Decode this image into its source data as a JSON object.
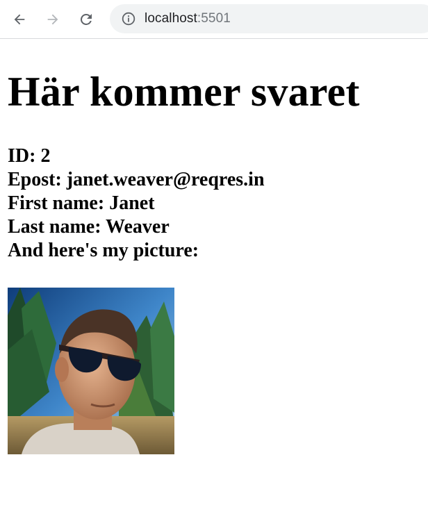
{
  "browser": {
    "url_host": "localhost",
    "url_port": ":5501"
  },
  "page": {
    "heading": "Här kommer svaret",
    "id_label": "ID: ",
    "id_value": "2",
    "email_label": "Epost: ",
    "email_value": "janet.weaver@reqres.in",
    "first_name_label": "First name: ",
    "first_name_value": "Janet",
    "last_name_label": "Last name: ",
    "last_name_value": "Weaver",
    "picture_caption": "And here's my picture:"
  },
  "icons": {
    "back": "arrow-left-icon",
    "forward": "arrow-right-icon",
    "reload": "reload-icon",
    "info": "info-icon"
  },
  "colors": {
    "icon": "#5f6368",
    "icon_disabled": "#b4b7bb",
    "omnibox_bg": "#f1f3f4"
  }
}
